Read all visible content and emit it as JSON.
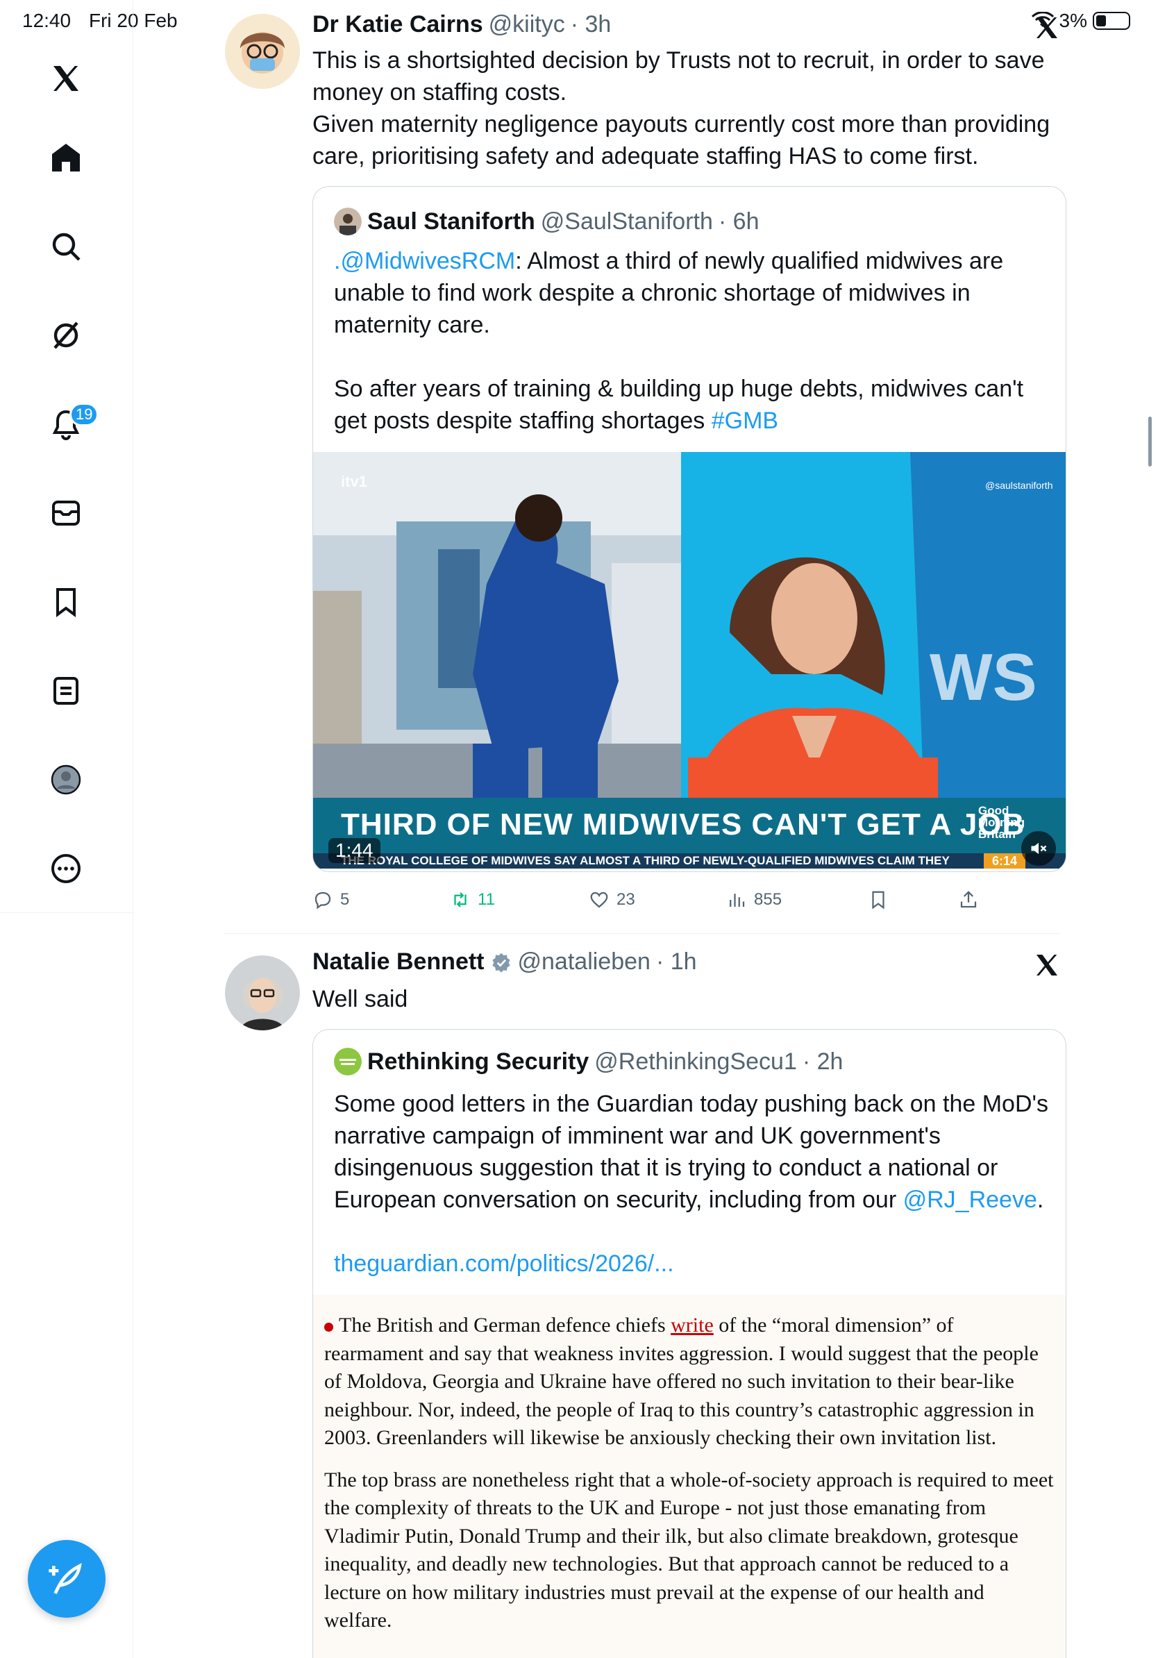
{
  "status_bar": {
    "time": "12:40",
    "date": "Fri 20 Feb",
    "battery": "3%"
  },
  "sidebar": {
    "notifications_badge": "19",
    "items": [
      "home",
      "search",
      "grok",
      "notifications",
      "messages",
      "bookmarks",
      "lists",
      "profile",
      "more"
    ]
  },
  "posts": [
    {
      "author": "Dr Katie Cairns",
      "handle": "@kiityc",
      "time": "· 3h",
      "text_lines": [
        "This is a shortsighted decision by Trusts not to recruit, in order to save",
        "money on staffing costs.",
        "Given maternity negligence payouts currently cost more than providing",
        "care, prioritising safety and adequate staffing HAS to come first."
      ],
      "quote": {
        "author": "Saul Staniforth",
        "handle": "@SaulStaniforth",
        "time": "· 6h",
        "mention": ".@MidwivesRCM",
        "text_p1_rest": ": Almost a third of newly qualified midwives are unable to find work despite a chronic shortage of midwives in maternity care.",
        "text_p2": "So after years of training & building up huge debts, midwives can't get posts despite staffing shortages ",
        "hashtag": "#GMB",
        "video": {
          "chyron": "THIRD OF NEW MIDWIVES CAN'T GET A JOB",
          "ticker": "THE ROYAL COLLEGE OF MIDWIVES SAY ALMOST A THIRD OF NEWLY-QUALIFIED MIDWIVES CLAIM THEY",
          "ticker_time": "6:14",
          "duration": "1:44",
          "watermark": "@saulstaniforth",
          "gmb_logo": [
            "Good",
            "Morning",
            "Britain"
          ],
          "backdrop_text": "WS",
          "channel_logo": "itv1"
        }
      },
      "stats": {
        "replies": "5",
        "reposts": "11",
        "likes": "23",
        "views": "855"
      }
    },
    {
      "author": "Natalie Bennett",
      "handle": "@natalieben",
      "time": "· 1h",
      "text": "Well said",
      "quote": {
        "author": "Rethinking Security",
        "handle": "@RethinkingSecu1",
        "time": "· 2h",
        "text": "Some good letters in the Guardian today pushing back on the MoD's narrative campaign of imminent war and UK government's disingenuous suggestion that it is trying to conduct a national or European conversation on security, including from our ",
        "mention": "@RJ_Reeve",
        "text_end": ".",
        "link": "theguardian.com/politics/2026/...",
        "article": {
          "p1_start": "The British and German defence chiefs ",
          "p1_link": "write",
          "p1_rest": " of the “moral dimension” of rearmament and say that weakness invites aggression. I would suggest that the people of Moldova, Georgia and Ukraine have offered no such invitation to their bear-like neighbour. Nor, indeed, the people of Iraq to this country’s catastrophic aggression in 2003. Greenlanders will likewise be anxiously checking their own invitation list.",
          "p2": "The top brass are nonetheless right that a whole-of-society approach is required to meet the complexity of threats to the UK and Europe - not just those emanating from Vladimir Putin, Donald Trump and their ilk, but also climate breakdown, grotesque inequality, and deadly new technologies. But that approach cannot be reduced to a lecture on how military industries must prevail at the expense of our health and welfare."
        }
      }
    }
  ],
  "colors": {
    "accent": "#1d9bf0",
    "repost_green": "#00ba7c",
    "text": "#0f1419",
    "secondary": "#536471",
    "guardian_red": "#c70000"
  }
}
